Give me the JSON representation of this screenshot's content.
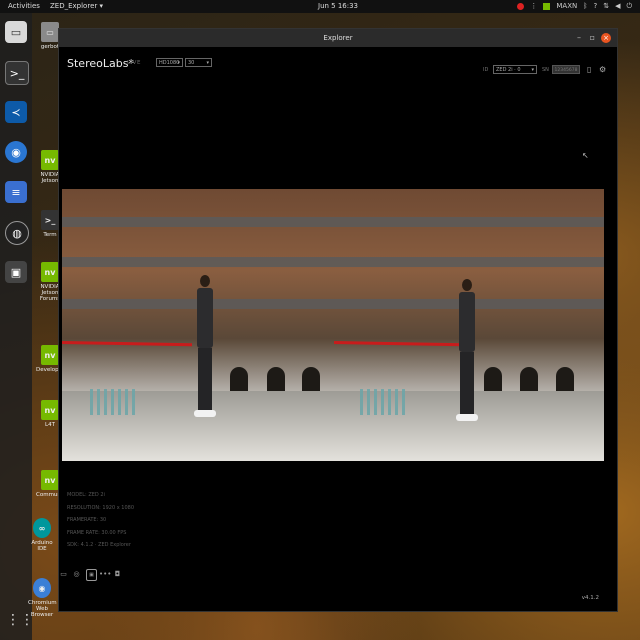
{
  "topbar": {
    "activities": "Activities",
    "app_menu": "ZED_Explorer ▾",
    "clock": "Jun 5 16:33",
    "power_mode": "MAXN"
  },
  "desktop_icons": [
    {
      "label": "gerbot",
      "icon": "folder-icon"
    },
    {
      "label": "NVIDIA Jetson",
      "icon": "nvidia-icon"
    },
    {
      "label": "Term",
      "icon": "terminal-icon"
    },
    {
      "label": "NVIDIA Jetson Forums",
      "icon": "nvidia-icon"
    },
    {
      "label": "Developer",
      "icon": "nvidia-icon"
    },
    {
      "label": "L4T",
      "icon": "nvidia-icon"
    },
    {
      "label": "Community",
      "icon": "nvidia-icon"
    },
    {
      "label": "Arduino IDE",
      "icon": "arduino-icon"
    },
    {
      "label": "Chromium Web Browser",
      "icon": "chromium-icon"
    }
  ],
  "dock_items": [
    {
      "name": "files-icon"
    },
    {
      "name": "terminal-icon"
    },
    {
      "name": "vscode-icon"
    },
    {
      "name": "chromium-icon"
    },
    {
      "name": "document-icon"
    },
    {
      "name": "obs-icon"
    }
  ],
  "window": {
    "title": "Explorer",
    "brand": "StereoLabs*",
    "live_label": "LIVE",
    "resolution_select": "HD1080",
    "fps_select": "30",
    "id_label": "ID",
    "camera_select": "ZED 2i · 0",
    "sn_label": "SN",
    "sn_value": "12345678",
    "info_lines": [
      "MODEL: ZED 2i",
      "RESOLUTION: 1920 x 1080",
      "FRAMERATE: 30",
      "FRAME RATE: 30.00 FPS",
      "SDK: 4.1.2 · ZED Explorer"
    ],
    "version": "v4.1.2"
  },
  "colors": {
    "close_button": "#e95420",
    "nvidia": "#76b900",
    "rope": "#c81c1c"
  }
}
